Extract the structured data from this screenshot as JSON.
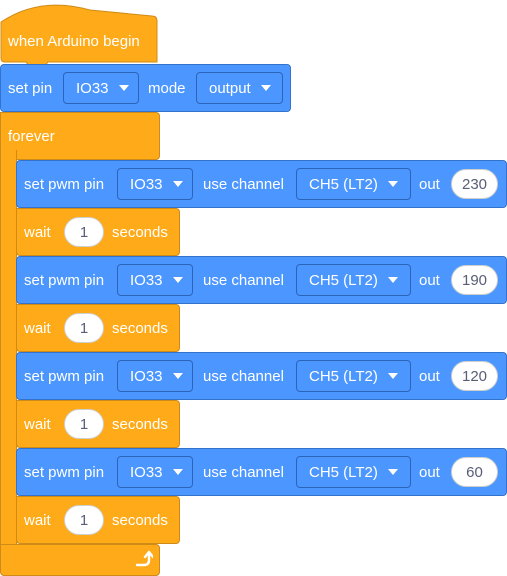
{
  "colors": {
    "motion": "#4C97FF",
    "control": "#FFAB19",
    "text": "#FFFFFF",
    "field_text": "#575E75"
  },
  "hat": {
    "label": "when Arduino begin"
  },
  "set_pin": {
    "label": "set pin",
    "pin": "IO33",
    "mode_label": "mode",
    "mode": "output"
  },
  "forever": {
    "label": "forever",
    "loop_icon": "loop-arrow-icon"
  },
  "pwm_steps": [
    {
      "label": "set pwm pin",
      "pin": "IO33",
      "channel_label": "use channel",
      "channel": "CH5 (LT2)",
      "out_label": "out",
      "value": "230",
      "wait": {
        "label": "wait",
        "value": "1",
        "unit": "seconds"
      }
    },
    {
      "label": "set pwm pin",
      "pin": "IO33",
      "channel_label": "use channel",
      "channel": "CH5 (LT2)",
      "out_label": "out",
      "value": "190",
      "wait": {
        "label": "wait",
        "value": "1",
        "unit": "seconds"
      }
    },
    {
      "label": "set pwm pin",
      "pin": "IO33",
      "channel_label": "use channel",
      "channel": "CH5 (LT2)",
      "out_label": "out",
      "value": "120",
      "wait": {
        "label": "wait",
        "value": "1",
        "unit": "seconds"
      }
    },
    {
      "label": "set pwm pin",
      "pin": "IO33",
      "channel_label": "use channel",
      "channel": "CH5 (LT2)",
      "out_label": "out",
      "value": "60",
      "wait": {
        "label": "wait",
        "value": "1",
        "unit": "seconds"
      }
    }
  ]
}
